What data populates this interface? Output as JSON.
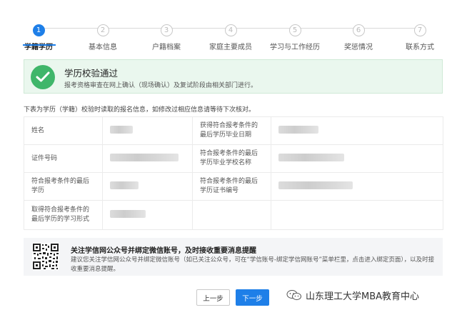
{
  "stepper": {
    "steps": [
      {
        "num": "1",
        "label": "学籍学历"
      },
      {
        "num": "2",
        "label": "基本信息"
      },
      {
        "num": "3",
        "label": "户籍档案"
      },
      {
        "num": "4",
        "label": "家庭主要成员"
      },
      {
        "num": "5",
        "label": "学习与工作经历"
      },
      {
        "num": "6",
        "label": "奖惩情况"
      },
      {
        "num": "7",
        "label": "联系方式"
      }
    ],
    "active_index": 0
  },
  "banner": {
    "title": "学历校验通过",
    "text": "报考资格审查在网上确认（现场确认）及复试阶段由相关部门进行。",
    "icon": "check-circle-icon",
    "color": "#3fb66a"
  },
  "intro": "下表为学历（学籍）校验时读取的报名信息，如修改过相应信息请等待下次核对。",
  "info": {
    "rows": [
      {
        "l1": "姓名",
        "l2": "获得符合报考条件的最后学历毕业日期"
      },
      {
        "l1": "证件号码",
        "l2": "符合报考条件的最后学历毕业学校名称"
      },
      {
        "l1": "符合报考条件的最后学历",
        "l2": "符合报考条件的最后学历证书编号"
      },
      {
        "l1": "取得符合报考条件的最后学历的学习形式",
        "l2": ""
      }
    ]
  },
  "notice": {
    "title": "关注学信网公众号并绑定微信账号，及时接收重要消息提醒",
    "text": "建议您关注学信网公众号并绑定微信账号（如已关注公众号，可在“学信账号-绑定学信网账号”菜单栏里，点击进入绑定页面），以及时接收重要消息提醒。",
    "icon": "qr-code-icon"
  },
  "buttons": {
    "prev": "上一步",
    "next": "下一步"
  },
  "watermark": {
    "text": "山东理工大学MBA教育中心",
    "icon": "wechat-icon"
  },
  "accent": "#1e7fe8"
}
